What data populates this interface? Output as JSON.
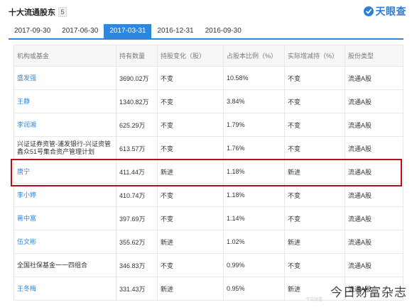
{
  "header": {
    "title": "十大流通股东",
    "count": "5",
    "brand_name": "天眼查"
  },
  "tabs": [
    {
      "label": "2017-09-30",
      "active": false
    },
    {
      "label": "2017-06-30",
      "active": false
    },
    {
      "label": "2017-03-31",
      "active": true
    },
    {
      "label": "2016-12-31",
      "active": false
    },
    {
      "label": "2016-09-30",
      "active": false
    }
  ],
  "table": {
    "headers": [
      "机构或基金",
      "持有数量",
      "持股变化（股）",
      "占股本比例（%）",
      "实际增减持（%）",
      "股份类型"
    ],
    "rows": [
      {
        "name": "盛发强",
        "amount": "3690.02万",
        "change": "不变",
        "ratio": "10.58%",
        "actual": "不变",
        "type": "流通A股",
        "link": true
      },
      {
        "name": "王静",
        "amount": "1340.82万",
        "change": "不变",
        "ratio": "3.84%",
        "actual": "不变",
        "type": "流通A股",
        "link": true
      },
      {
        "name": "李润湘",
        "amount": "625.29万",
        "change": "不变",
        "ratio": "1.79%",
        "actual": "不变",
        "type": "流通A股",
        "link": true
      },
      {
        "name": "兴证证券资管-浦发银行-兴证资管鑫众51号集合资产管理计划",
        "amount": "613.57万",
        "change": "不变",
        "ratio": "1.76%",
        "actual": "不变",
        "type": "流通A股",
        "link": false
      },
      {
        "name": "唐宁",
        "amount": "411.44万",
        "change": "新进",
        "ratio": "1.18%",
        "actual": "新进",
        "type": "流通A股",
        "link": true
      },
      {
        "name": "李小婷",
        "amount": "410.74万",
        "change": "不变",
        "ratio": "1.18%",
        "actual": "不变",
        "type": "流通A股",
        "link": true
      },
      {
        "name": "蒋中富",
        "amount": "397.69万",
        "change": "不变",
        "ratio": "1.14%",
        "actual": "不变",
        "type": "流通A股",
        "link": true
      },
      {
        "name": "伍文彬",
        "amount": "355.62万",
        "change": "新进",
        "ratio": "1.02%",
        "actual": "新进",
        "type": "流通A股",
        "link": true
      },
      {
        "name": "全国社保基金一一四组合",
        "amount": "346.83万",
        "change": "不变",
        "ratio": "0.99%",
        "actual": "不变",
        "type": "流通A股",
        "link": false
      },
      {
        "name": "王冬梅",
        "amount": "331.43万",
        "change": "新进",
        "ratio": "0.95%",
        "actual": "新进",
        "type": "流通A股",
        "link": true
      }
    ]
  },
  "watermark": {
    "text": "今日财富杂志",
    "small_text": "今日财富"
  },
  "colors": {
    "accent": "#2f86dc",
    "highlight": "#b90f1a",
    "header_bg": "#f6f7f9",
    "border": "#e6e8eb"
  }
}
